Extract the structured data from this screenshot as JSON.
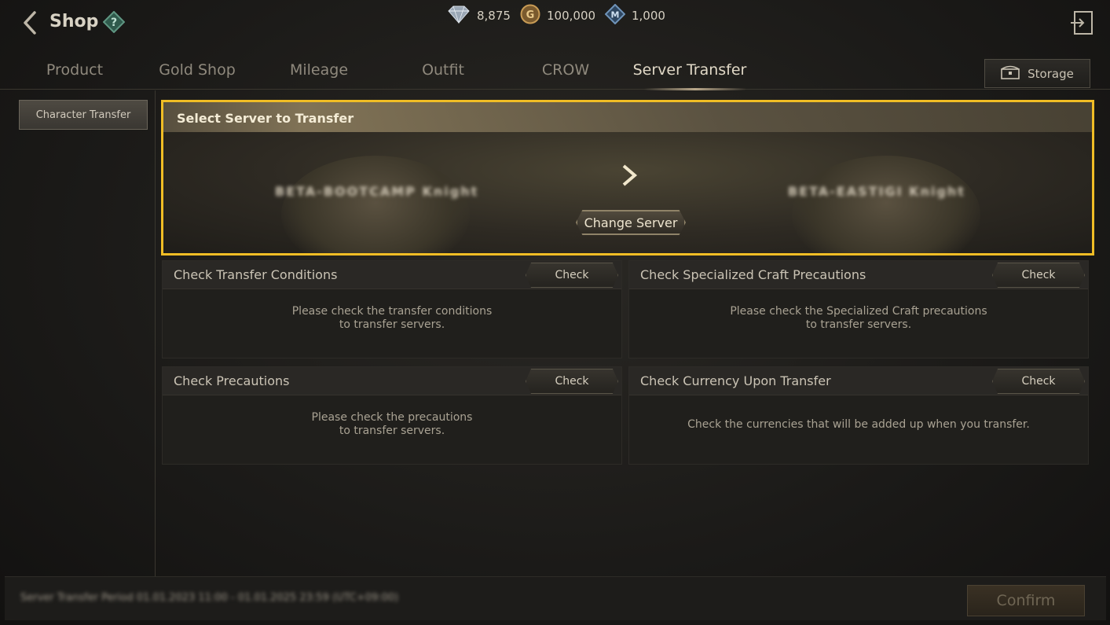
{
  "header": {
    "title": "Shop",
    "currencies": [
      {
        "icon": "diamond-icon",
        "value": "8,875"
      },
      {
        "icon": "gold-coin-icon",
        "value": "100,000"
      },
      {
        "icon": "mileage-icon",
        "value": "1,000"
      }
    ]
  },
  "tabs": [
    {
      "label": "Product"
    },
    {
      "label": "Gold Shop"
    },
    {
      "label": "Mileage"
    },
    {
      "label": "Outfit"
    },
    {
      "label": "CROW"
    },
    {
      "label": "Server Transfer",
      "active": true
    }
  ],
  "storage_label": "Storage",
  "sidebar": {
    "items": [
      {
        "label": "Character Transfer",
        "active": true
      }
    ]
  },
  "server_panel": {
    "title": "Select Server to Transfer",
    "from_server": "BETA-BOOTCAMP  Knight",
    "to_server": "BETA-EASTIGI  Knight",
    "change_label": "Change Server"
  },
  "cards": [
    {
      "title": "Check Transfer Conditions",
      "button": "Check",
      "line1": "Please check the transfer conditions",
      "line2": "to transfer servers."
    },
    {
      "title": "Check Specialized Craft Precautions",
      "button": "Check",
      "line1": "Please check the Specialized Craft precautions",
      "line2": "to transfer servers."
    },
    {
      "title": "Check Precautions",
      "button": "Check",
      "line1": "Please check the precautions",
      "line2": "to transfer servers."
    },
    {
      "title": "Check Currency Upon Transfer",
      "button": "Check",
      "line1": "Check the currencies that will be added up when you transfer.",
      "line2": ""
    }
  ],
  "footer": {
    "note": "Server Transfer Period 01.01.2023 11:00 - 01.01.2025 23:59 (UTC+09:00)",
    "confirm_label": "Confirm"
  },
  "colors": {
    "highlight": "#f0bd25",
    "background": "#1b1a18"
  }
}
